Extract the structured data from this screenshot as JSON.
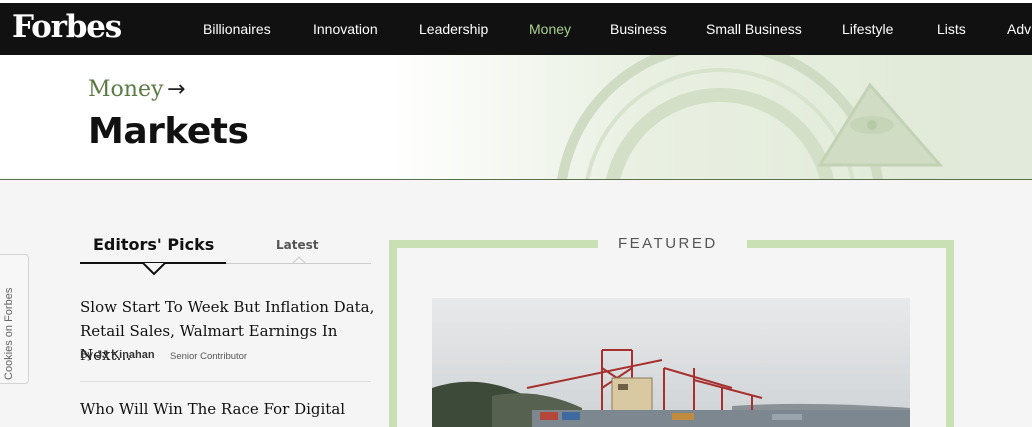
{
  "brand": {
    "logo_text": "Forbes"
  },
  "nav": {
    "items": [
      {
        "label": "Billionaires",
        "active": false
      },
      {
        "label": "Innovation",
        "active": false
      },
      {
        "label": "Leadership",
        "active": false
      },
      {
        "label": "Money",
        "active": true
      },
      {
        "label": "Business",
        "active": false
      },
      {
        "label": "Small Business",
        "active": false
      },
      {
        "label": "Lifestyle",
        "active": false
      },
      {
        "label": "Lists",
        "active": false
      },
      {
        "label": "Advi",
        "active": false
      }
    ]
  },
  "hero": {
    "breadcrumb": "Money",
    "breadcrumb_arrow": "→",
    "title": "Markets"
  },
  "cookies_tab": {
    "label": "Cookies on Forbes"
  },
  "editors_picks": {
    "tabs": [
      {
        "label": "Editors' Picks",
        "active": true
      },
      {
        "label": "Latest",
        "active": false
      }
    ],
    "stories": [
      {
        "title": "Slow Start To Week But Inflation Data, Retail Sales, Walmart Earnings In Next…",
        "author": "JJ Kinahan",
        "byline_prefix": "By",
        "role": "Senior Contributor"
      },
      {
        "title": "Who Will Win The Race For Digital"
      }
    ]
  },
  "featured": {
    "label": "FEATURED",
    "image": "container port with cranes"
  },
  "colors": {
    "nav_bg": "#111111",
    "nav_active": "#a8d08d",
    "breadcrumb": "#5b7a44",
    "featured_border": "#c8e0b3"
  }
}
